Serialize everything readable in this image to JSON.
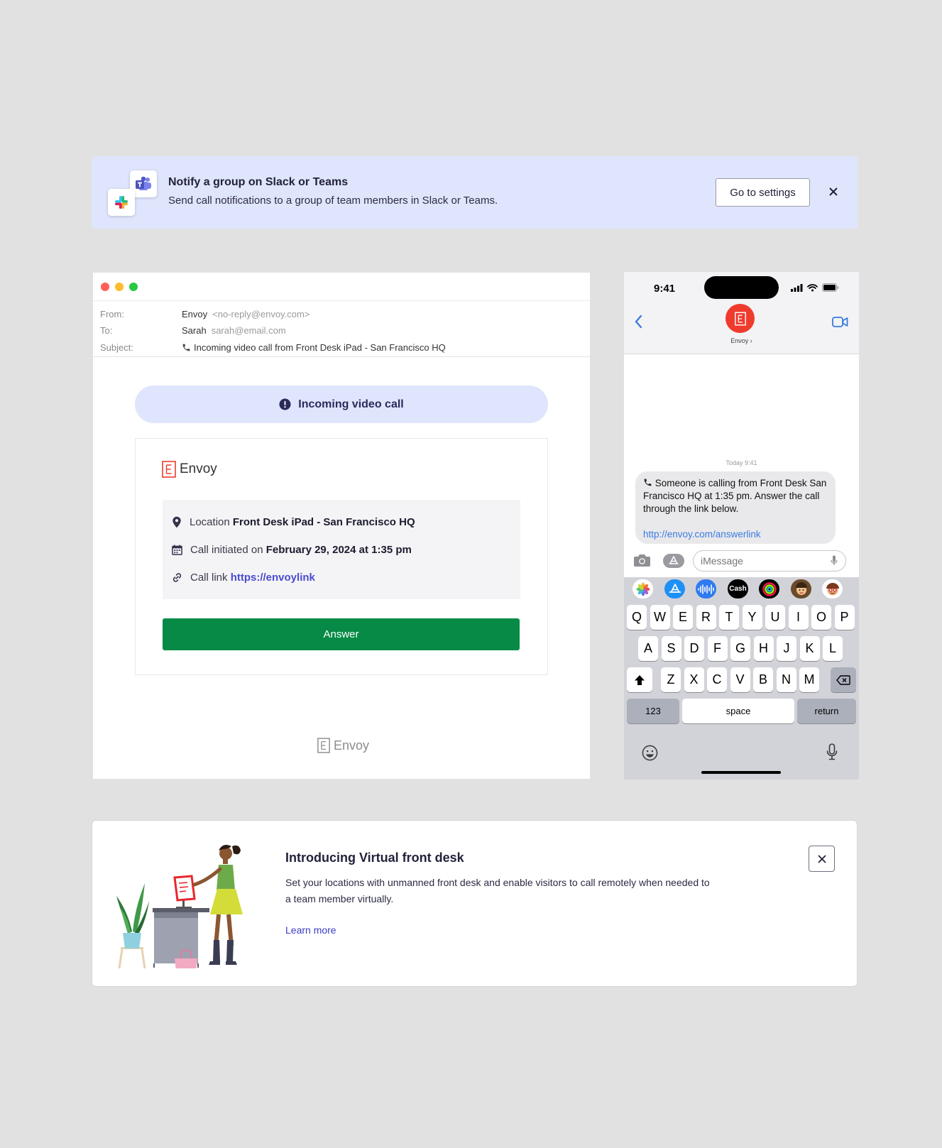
{
  "banner": {
    "title": "Notify a group on Slack or Teams",
    "text": "Send call notifications to a group of team members in Slack or Teams.",
    "button_label": "Go to settings",
    "icons": [
      "teams-icon",
      "slack-icon",
      "close-icon"
    ]
  },
  "email": {
    "header": {
      "from_label": "From:",
      "from_name": "Envoy",
      "from_address": "<no-reply@envoy.com>",
      "to_label": "To:",
      "to_name": "Sarah",
      "to_address": "sarah@email.com",
      "subject_label": "Subject:",
      "subject": "Incoming video call from Front Desk iPad - San Francisco HQ"
    },
    "alert_text": "Incoming video call",
    "brand_name": "Envoy",
    "location_label": "Location",
    "location_value": "Front Desk iPad - San Francisco HQ",
    "initiated_label": "Call initiated on",
    "initiated_value": "February 29, 2024 at 1:35 pm",
    "link_label": "Call link",
    "link_value": "https://envoylink",
    "answer_label": "Answer",
    "footer_brand": "Envoy"
  },
  "phone": {
    "time": "9:41",
    "contact_name": "Envoy ›",
    "timestamp": "Today 9:41",
    "message": "Someone is calling from Front Desk San Francisco HQ at 1:35 pm. Answer the call through the link below.",
    "message_link": "http://envoy.com/answerlink",
    "input_placeholder": "iMessage",
    "apps": [
      "photos-icon",
      "app-store-icon",
      "audio-icon",
      "cash-icon",
      "activity-icon",
      "memoji-icon",
      "memoji-2-icon"
    ],
    "cash_label": "Cash",
    "keyboard": {
      "row1": [
        "Q",
        "W",
        "E",
        "R",
        "T",
        "Y",
        "U",
        "I",
        "O",
        "P"
      ],
      "row2": [
        "A",
        "S",
        "D",
        "F",
        "G",
        "H",
        "J",
        "K",
        "L"
      ],
      "row3": [
        "Z",
        "X",
        "C",
        "V",
        "B",
        "N",
        "M"
      ],
      "numbers": "123",
      "space": "space",
      "return": "return"
    }
  },
  "intro": {
    "title": "Introducing Virtual front desk",
    "text": "Set your locations with unmanned front desk and enable visitors to call remotely when needed to a team member virtually.",
    "link": "Learn more"
  },
  "colors": {
    "background": "#e1e1e1",
    "banner_bg": "#dfe5fc",
    "answer_green": "#078a45",
    "link_purple": "#4a4ad0",
    "envoy_red": "#ef3b2d",
    "imessage_blue": "#3a7be0"
  }
}
